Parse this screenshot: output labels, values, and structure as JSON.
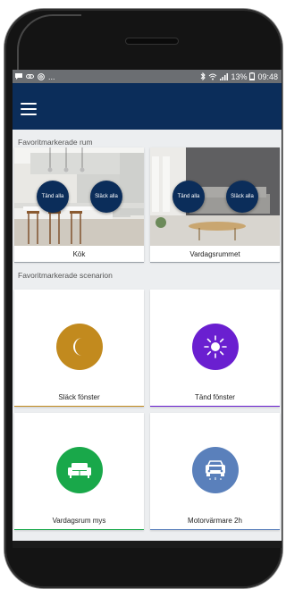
{
  "status_bar": {
    "left_icons": [
      "message-icon",
      "link-icon",
      "at-icon"
    ],
    "left_ellipsis": "...",
    "right_icons": [
      "bluetooth-icon",
      "wifi-icon",
      "signal-icon"
    ],
    "battery_text": "13%",
    "time": "09:48"
  },
  "app_bar": {
    "background": "#0b2d5a",
    "menu_icon": "hamburger-menu-icon"
  },
  "rooms": {
    "title": "Favoritmarkerade rum",
    "items": [
      {
        "label": "Kök",
        "on_button": "Tänd alla",
        "off_button": "Släck alla"
      },
      {
        "label": "Vardagsrummet",
        "on_button": "Tänd alla",
        "off_button": "Släck alla"
      }
    ]
  },
  "scenarios": {
    "title": "Favoritmarkerade scenarion",
    "items": [
      {
        "label": "Släck fönster",
        "icon": "moon-icon",
        "icon_color": "#c28a1e",
        "line_color": "#c28a1e"
      },
      {
        "label": "Tänd fönster",
        "icon": "sun-icon",
        "icon_color": "#6a1fd0",
        "line_color": "#6a1fd0"
      },
      {
        "label": "Vardagsrum mys",
        "icon": "sofa-icon",
        "icon_color": "#19a84a",
        "line_color": "#19a84a"
      },
      {
        "label": "Motorvärmare 2h",
        "icon": "car-icon",
        "icon_color": "#5a80bb",
        "line_color": "#5a80bb"
      }
    ]
  }
}
